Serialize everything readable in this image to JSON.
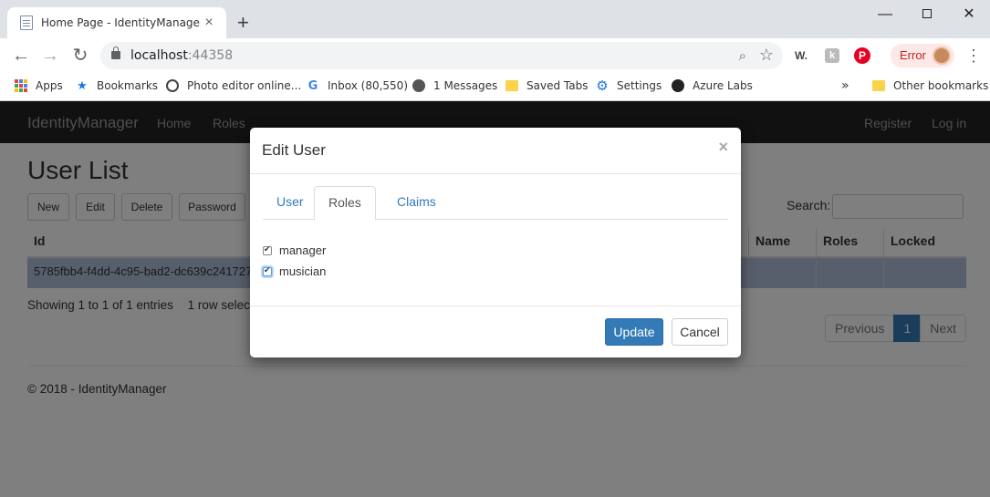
{
  "browser": {
    "tab_title": "Home Page - IdentityManager",
    "tab_close": "×",
    "new_tab": "+",
    "window_min": "—",
    "window_close": "✕",
    "url_host": "localhost",
    "url_port": ":44358",
    "error_label": "Error",
    "ext_w": "W.",
    "ext_k": "k",
    "ext_p": "P",
    "bookmarks": [
      {
        "label": "Apps",
        "icon": "apps-icon"
      },
      {
        "label": "Bookmarks",
        "icon": "star-icon"
      },
      {
        "label": "Photo editor online...",
        "icon": "photo-editor-icon"
      },
      {
        "label": "Inbox (80,550)",
        "icon": "google-icon"
      },
      {
        "label": "1 Messages",
        "icon": "globe-icon"
      },
      {
        "label": "Saved Tabs",
        "icon": "folder-icon"
      },
      {
        "label": "Settings",
        "icon": "gear-icon"
      },
      {
        "label": "Azure Labs",
        "icon": "github-icon"
      }
    ],
    "bookmarks_overflow": "»",
    "other_bookmarks": "Other bookmarks"
  },
  "navbar": {
    "brand": "IdentityManager",
    "left_links": [
      "Home",
      "Roles"
    ],
    "right_links": [
      "Register",
      "Log in"
    ]
  },
  "page": {
    "title": "User List",
    "buttons": [
      "New",
      "Edit",
      "Delete",
      "Password"
    ],
    "search_label": "Search:",
    "search_value": "",
    "columns": [
      "Id",
      "Name",
      "Roles",
      "Locked"
    ],
    "rows": [
      {
        "id": "5785fbb4-f4dd-4c95-bad2-dc639c241727",
        "name": "",
        "roles": "",
        "locked": ""
      }
    ],
    "info": "Showing 1 to 1 of 1 entries",
    "selection_info": "1 row selected",
    "pager": {
      "previous": "Previous",
      "current": "1",
      "next": "Next"
    },
    "footer": "© 2018 - IdentityManager"
  },
  "modal": {
    "title": "Edit User",
    "close": "×",
    "tabs": [
      "User",
      "Roles",
      "Claims"
    ],
    "active_tab": "Roles",
    "roles": [
      {
        "label": "manager",
        "checked": true
      },
      {
        "label": "musician",
        "checked": true
      }
    ],
    "update_label": "Update",
    "cancel_label": "Cancel"
  }
}
